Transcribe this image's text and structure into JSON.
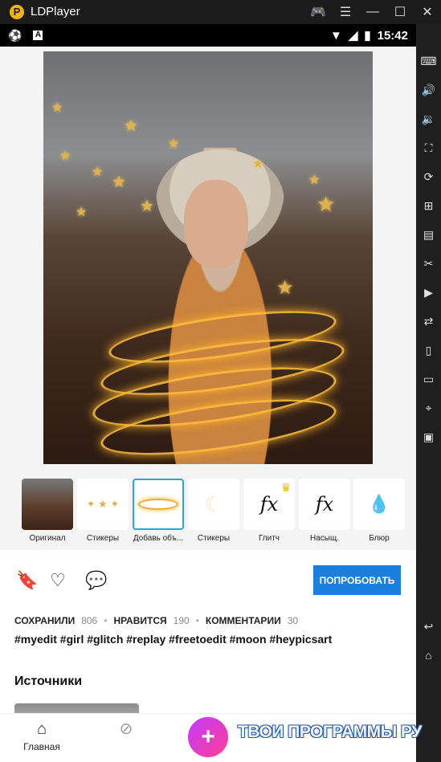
{
  "window": {
    "title": "LDPlayer",
    "buttons": [
      "gamepad-icon",
      "menu-icon",
      "minimize-icon",
      "maximize-icon",
      "close-icon"
    ]
  },
  "status_bar": {
    "time": "15:42",
    "left_icons": [
      "soccer-ball-icon",
      "a-icon"
    ],
    "right_icons": [
      "wifi-icon",
      "signal-icon",
      "battery-icon"
    ]
  },
  "side_toolbar": [
    "keyboard-icon",
    "volume-up-icon",
    "volume-down-icon",
    "screenshot-icon",
    "rotate-icon",
    "add-app-icon",
    "apk-icon",
    "scissors-icon",
    "record-icon",
    "sync-icon",
    "shake-icon",
    "folder-icon",
    "location-icon",
    "vibrate-icon",
    "back-icon",
    "home-icon"
  ],
  "filters": [
    {
      "label": "Оригинал",
      "thumb": "photo"
    },
    {
      "label": "Стикеры",
      "thumb": "stars"
    },
    {
      "label": "Добавь объ...",
      "thumb": "glow",
      "selected": true
    },
    {
      "label": "Стикеры",
      "thumb": "moon"
    },
    {
      "label": "Глитч",
      "thumb": "fx",
      "premium": true
    },
    {
      "label": "Насыщ.",
      "thumb": "fx"
    },
    {
      "label": "Блюр",
      "thumb": "drop"
    }
  ],
  "fx_text": "fx",
  "actions": {
    "try_button": "ПОПРОБОВАТЬ"
  },
  "stats": {
    "saved_label": "СОХРАНИЛИ",
    "saved_count": "806",
    "likes_label": "НРАВИТСЯ",
    "likes_count": "190",
    "comments_label": "КОММЕНТАРИИ",
    "comments_count": "30"
  },
  "hashtags": "#myedit #girl #glitch #replay #freetoedit #moon #heypicsart",
  "sources_title": "Источники",
  "nav": {
    "home_label": "Главная",
    "plus": "+"
  },
  "watermark": "ТВОИ ПРОГРАММЫ РУ",
  "colors": {
    "accent": "#1b7fe0",
    "selected_border": "#2aa6d8",
    "fab_start": "#c13cff",
    "fab_end": "#ff3d94",
    "premium": "#f5b400"
  }
}
